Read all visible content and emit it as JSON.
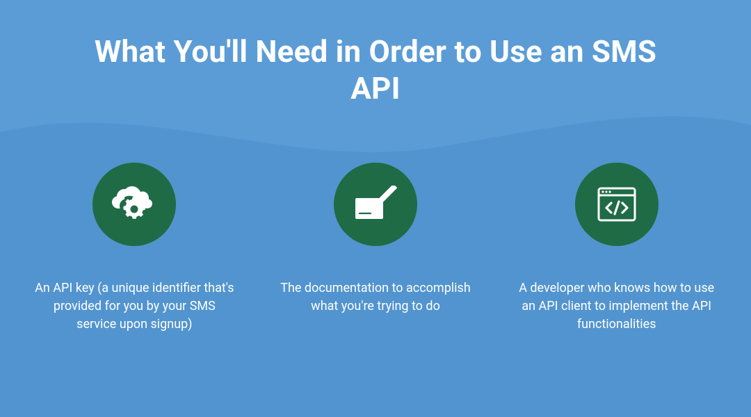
{
  "title": "What You'll Need in Order to Use an SMS API",
  "colors": {
    "background_top": "#5b9cd6",
    "background_bottom": "#5294cf",
    "icon_circle": "#1f6b45",
    "text": "#ffffff"
  },
  "items": [
    {
      "icon": "cloud-gear-icon",
      "caption": "An API key (a unique identifier that's provided for you by your SMS service upon signup)"
    },
    {
      "icon": "write-icon",
      "caption": "The documentation to accomplish what you're trying to do"
    },
    {
      "icon": "code-window-icon",
      "caption": "A developer who knows how to use an API client to implement the API functionalities"
    }
  ]
}
